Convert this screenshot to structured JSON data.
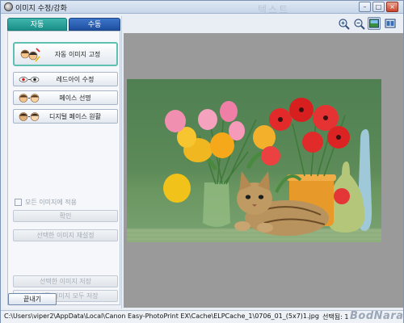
{
  "window": {
    "title": "이미지 수정/강화",
    "ghost_title": "텍스트",
    "controls": {
      "minimize": "–",
      "maximize": "□",
      "close": "×"
    }
  },
  "tabs": [
    {
      "label": "자동",
      "active": true
    },
    {
      "label": "수동",
      "active": false
    }
  ],
  "features": [
    {
      "label": "자동 이미지 고정",
      "icon": "auto-fix-icon"
    },
    {
      "label": "레드아이 수정",
      "icon": "red-eye-icon"
    },
    {
      "label": "페이스 선명",
      "icon": "face-sharpen-icon"
    },
    {
      "label": "디지털 페이스 원활",
      "icon": "digital-face-smoothing-icon"
    }
  ],
  "apply_all": {
    "label": "모든 이미지에 적용",
    "checked": false
  },
  "buttons": {
    "ok": "확인",
    "reset_selected": "선택한 이미지 재설정",
    "save_selected": "선택한 이미지 저장",
    "save_all_modified": "수정된 이미지 모두 저장",
    "close": "끝내기"
  },
  "toolbar": [
    {
      "icon": "zoom-in-icon",
      "active": false
    },
    {
      "icon": "zoom-out-icon",
      "active": false
    },
    {
      "icon": "single-view-icon",
      "active": true
    },
    {
      "icon": "compare-view-icon",
      "active": false
    }
  ],
  "status": {
    "path": "C:\\Users\\viper2\\AppData\\Local\\Canon Easy-PhotoPrint EX\\Cache\\ELPCache_1\\0706_01_(5x7)1.jpg",
    "selected": "선택됨: 1"
  },
  "watermark": "BodNara",
  "colors": {
    "tab_auto": "#1a8f88",
    "tab_manual": "#1e4f9f",
    "highlight_border": "#5ec0b0",
    "viewer_bg": "#9a9a9a"
  }
}
